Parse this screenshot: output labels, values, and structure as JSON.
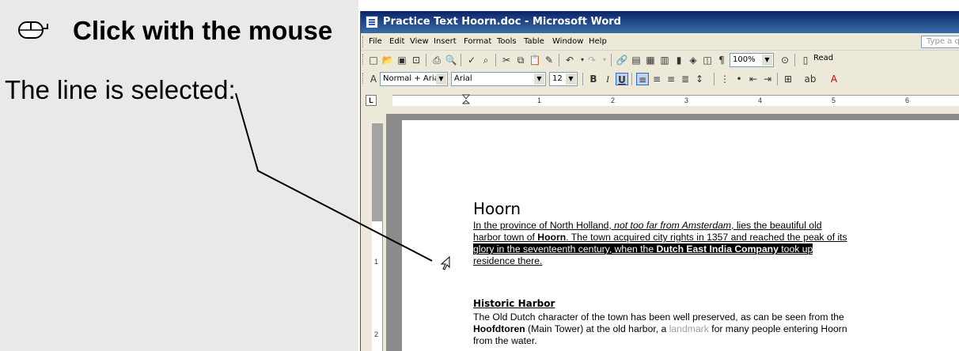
{
  "left_panel": {
    "title": "Click with the mouse",
    "caption": "The line is selected:"
  },
  "window": {
    "title": "Practice Text Hoorn.doc - Microsoft Word"
  },
  "menu": {
    "items": [
      "File",
      "Edit",
      "View",
      "Insert",
      "Format",
      "Tools",
      "Table",
      "Window",
      "Help"
    ],
    "ask_placeholder": "Type a qu"
  },
  "standard_toolbar": {
    "zoom": "100%",
    "read_label": "Read"
  },
  "formatting_toolbar": {
    "style": "Normal + Arial,",
    "font": "Arial",
    "size": "12"
  },
  "ruler": {
    "numbers": [
      "1",
      "2",
      "3",
      "4",
      "5",
      "6"
    ],
    "vertical_numbers": [
      "1",
      "2"
    ]
  },
  "document": {
    "heading": "Hoorn",
    "para1": {
      "line1_a": "In the province of North Holland, ",
      "line1_italic": "not too far from Amsterdam",
      "line1_b": ", lies the beautiful old",
      "line2_a": "harbor town of ",
      "line2_bold": "Hoorn",
      "line2_b": ". The town acquired city rights in 1357 and reached the peak of its",
      "line3_a": "glory in the seventeenth century, when the ",
      "line3_bold": "Dutch East India Company",
      "line3_b": " took up",
      "line4": "residence there."
    },
    "subheading": "Historic Harbor",
    "para2": {
      "line1": "The Old Dutch character of the town has been well preserved, as can be seen from the",
      "line2_bold": "Hoofdtoren",
      "line2_a": " (Main Tower) at the old harbor, a ",
      "line2_light": "landmark",
      "line2_b": " for many people entering Hoorn",
      "line3": "from the water."
    }
  },
  "colors": {
    "panel_bg": "#e9e9e9",
    "title_bar": "#0a246a",
    "selection": "#000000"
  }
}
